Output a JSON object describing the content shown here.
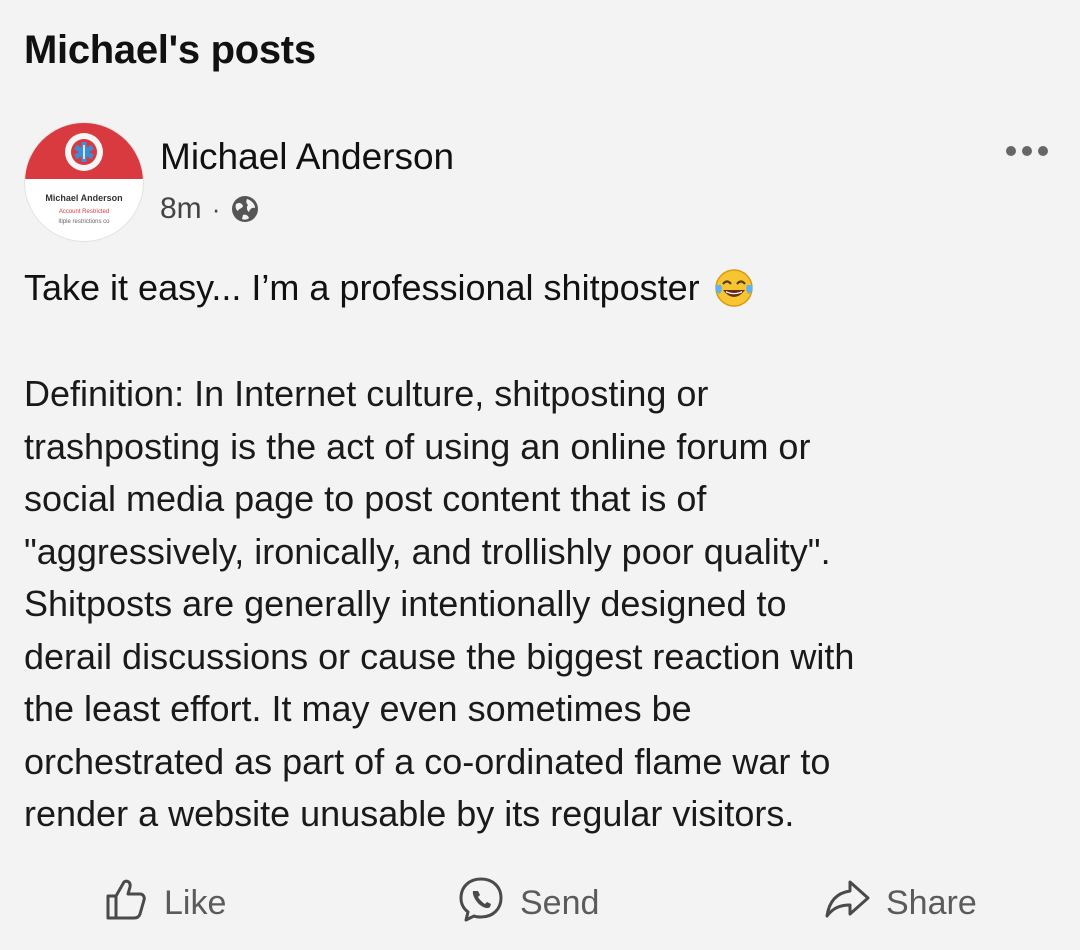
{
  "section": {
    "title": "Michael's posts"
  },
  "post": {
    "author": "Michael Anderson",
    "time": "8m",
    "separator": "·",
    "avatar": {
      "name": "Michael Anderson",
      "status": "Account Restricted",
      "sub": "ltiple restrictions co"
    },
    "lead_text": "Take it easy... I’m a professional shitposter",
    "emoji": "tears-of-joy-emoji",
    "body": "Definition: In Internet culture, shitposting or\ntrashposting is the act of using an online forum or\nsocial media page to post content that is of\n\"aggressively, ironically, and trollishly poor quality\".\nShitposts are generally intentionally designed to\nderail discussions or cause the biggest reaction with\nthe least effort. It may even sometimes be\norchestrated as part of a co-ordinated flame war to\nrender a website unusable by its regular visitors."
  },
  "actions": {
    "like": "Like",
    "send": "Send",
    "share": "Share"
  },
  "icons": {
    "like": "thumbs-up-icon",
    "send": "messenger-icon",
    "share": "share-arrow-icon",
    "privacy": "globe-icon",
    "more": "more-dots-icon"
  },
  "colors": {
    "background": "#f3f3f3",
    "text": "#111111",
    "muted": "#5b5b5b",
    "avatar_accent": "#d93a3f"
  }
}
